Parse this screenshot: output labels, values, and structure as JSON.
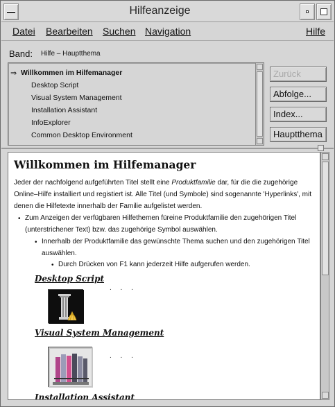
{
  "window": {
    "title": "Hilfeanzeige"
  },
  "menubar": {
    "datei": "Datei",
    "bearbeiten": "Bearbeiten",
    "suchen": "Suchen",
    "navigation": "Navigation",
    "hilfe": "Hilfe"
  },
  "band": {
    "label": "Band:",
    "value": "Hilfe – Hauptthema"
  },
  "topics": {
    "current_marker": "⇒",
    "items": [
      "Willkommen im Hilfemanager",
      "Desktop Script",
      "Visual System Management",
      "Installation Assistant",
      "InfoExplorer",
      "Common Desktop Environment"
    ]
  },
  "buttons": {
    "zurueck": "Zurück",
    "abfolge": "Abfolge...",
    "index": "Index...",
    "hauptthema": "Hauptthema"
  },
  "content": {
    "heading": "Willkommen im Hilfemanager",
    "intro_1": "Jeder der nachfolgend aufgeführten Titel stellt eine ",
    "intro_em": "Produktfamilie",
    "intro_2": " dar, für die die zugehörige Online–Hilfe installiert und registiert ist. Alle Titel (und Symbole) sind sogenannte 'Hyperlinks', mit denen die Hilfetexte innerhalb der Familie aufgelistet werden.",
    "bullet_1": "Zum Anzeigen der verfügbaren Hilfethemen füreine Produktfamilie den zugehörigen Titel (unterstrichener Text) bzw. das zugehörige Symbol auswählen.",
    "bullet_2": "Innerhalb der Produktfamilie das gewünschte Thema suchen und den zugehörigen Titel auswählen.",
    "bullet_3": "Durch Drücken von F1 kann jederzeit Hilfe aufgerufen werden.",
    "link_1": "Desktop Script",
    "link_2": "Visual System Management",
    "link_3": "Installation Assistant",
    "dots": ". . ."
  }
}
